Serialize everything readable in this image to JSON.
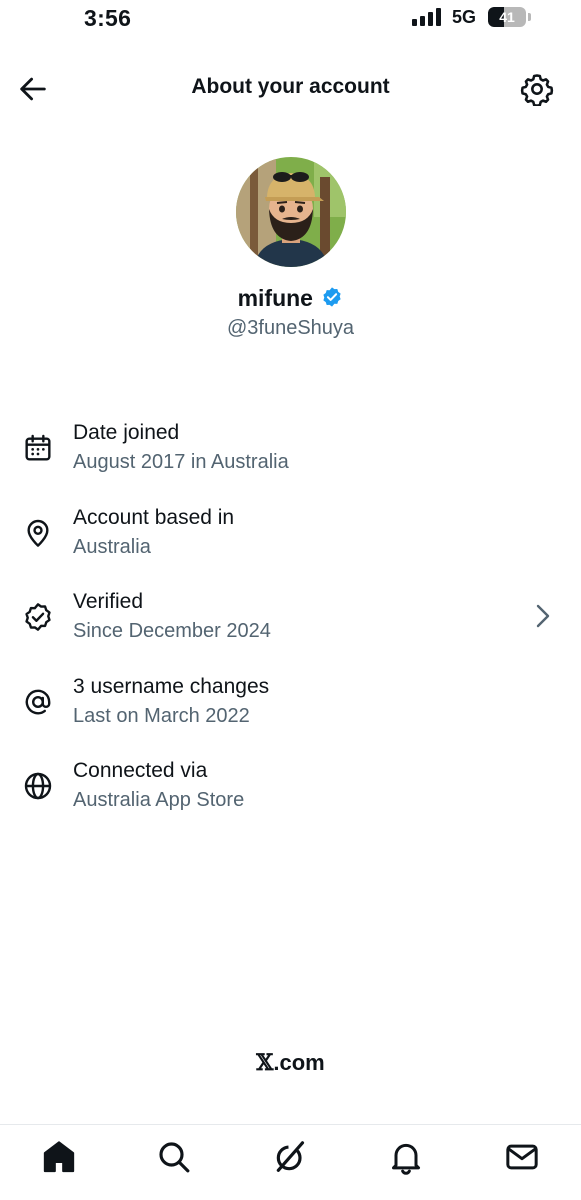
{
  "status_bar": {
    "time": "3:56",
    "network": "5G",
    "battery_level": "41"
  },
  "header": {
    "title": "About your account",
    "back_icon": "arrow-left-icon",
    "settings_icon": "gear-icon"
  },
  "profile": {
    "display_name": "mifune",
    "handle": "@3funeShuya",
    "verified_badge_color": "#1d9bf0"
  },
  "info_items": [
    {
      "icon": "calendar-icon",
      "title": "Date joined",
      "subtitle": "August 2017 in Australia"
    },
    {
      "icon": "location-pin-icon",
      "title": "Account based in",
      "subtitle": "Australia"
    },
    {
      "icon": "verified-check-icon",
      "title": "Verified",
      "subtitle": "Since December 2024",
      "has_chevron": true
    },
    {
      "icon": "at-sign-icon",
      "title": "3 username changes",
      "subtitle": "Last on March 2022"
    },
    {
      "icon": "globe-icon",
      "title": "Connected via",
      "subtitle": "Australia App Store"
    }
  ],
  "footer": {
    "brand_mark": "𝕏",
    "brand_suffix": ".com"
  },
  "tab_bar": {
    "tabs": [
      "home-icon",
      "search-icon",
      "grok-icon",
      "notifications-bell-icon",
      "messages-envelope-icon"
    ]
  },
  "colors": {
    "text_primary": "#0f1419",
    "text_secondary": "#536471",
    "accent": "#1d9bf0"
  }
}
